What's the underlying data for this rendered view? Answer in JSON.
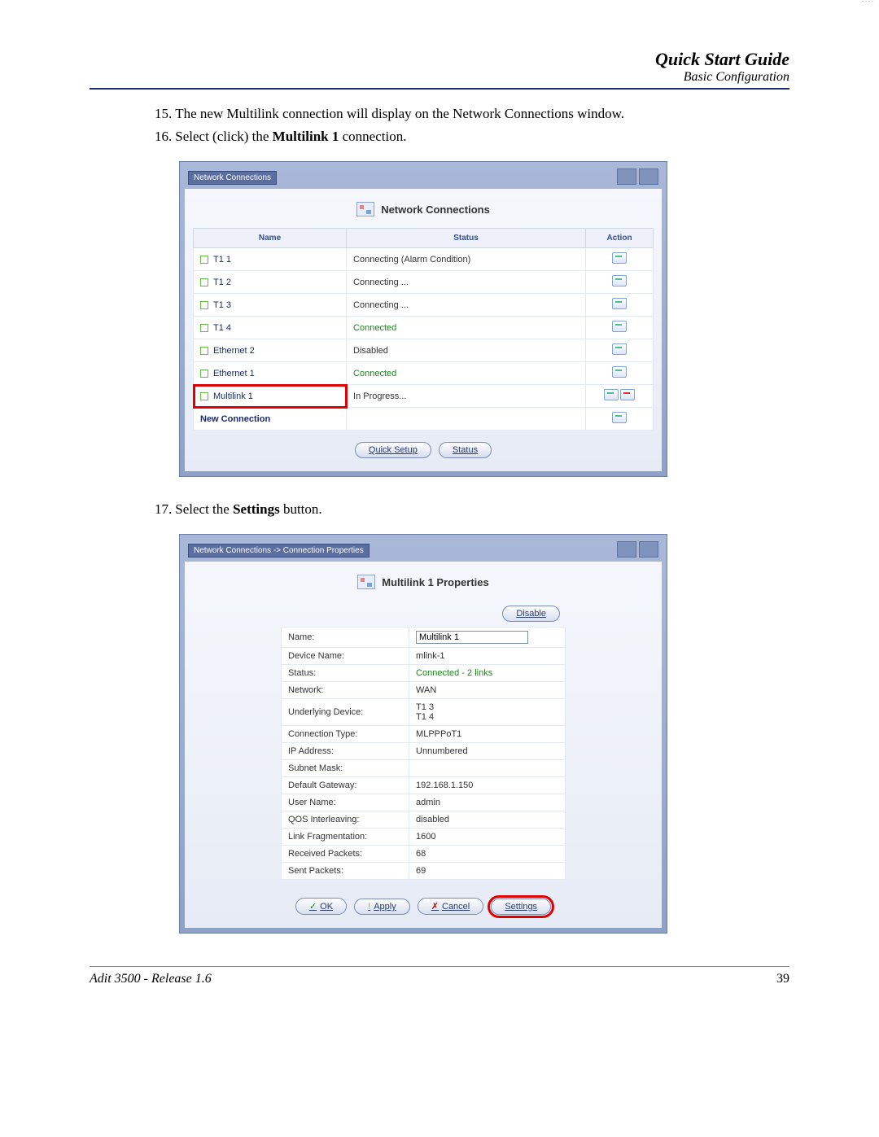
{
  "header": {
    "title": "Quick Start Guide",
    "subtitle": "Basic Configuration"
  },
  "steps": {
    "s15": {
      "num": "15.",
      "text": "The new Multilink connection will display on the Network Connections window."
    },
    "s16": {
      "num": "16.",
      "pre": "Select (click) the ",
      "bold": "Multilink 1",
      "post": " connection."
    },
    "s17": {
      "num": "17.",
      "pre": "Select the ",
      "bold": "Settings",
      "post": " button."
    }
  },
  "panel1": {
    "breadcrumb": "Network Connections",
    "heading": "Network Connections",
    "columns": {
      "name": "Name",
      "status": "Status",
      "action": "Action"
    },
    "rows": [
      {
        "name": "T1 1",
        "status": "Connecting (Alarm Condition)",
        "green": false
      },
      {
        "name": "T1 2",
        "status": "Connecting ...",
        "green": false
      },
      {
        "name": "T1 3",
        "status": "Connecting ...",
        "green": false
      },
      {
        "name": "T1 4",
        "status": "Connected",
        "green": true
      },
      {
        "name": "Ethernet 2",
        "status": "Disabled",
        "green": false
      },
      {
        "name": "Ethernet 1",
        "status": "Connected",
        "green": true
      },
      {
        "name": "Multilink 1",
        "status": "In Progress...",
        "green": false,
        "highlight": true,
        "deletable": true
      }
    ],
    "newConnection": "New Connection",
    "buttons": {
      "quickSetup": "Quick Setup",
      "status": "Status"
    }
  },
  "panel2": {
    "breadcrumb": "Network Connections -> Connection Properties",
    "heading": "Multilink 1 Properties",
    "disable": "Disable",
    "nameInput": "Multilink 1",
    "props": [
      {
        "k": "Name:",
        "v": "__input__"
      },
      {
        "k": "Device Name:",
        "v": "mlink-1"
      },
      {
        "k": "Status:",
        "v": "Connected - 2 links",
        "green": true
      },
      {
        "k": "Network:",
        "v": "WAN"
      },
      {
        "k": "Underlying Device:",
        "v": "T1 3\nT1 4"
      },
      {
        "k": "Connection Type:",
        "v": "MLPPPoT1"
      },
      {
        "k": "IP Address:",
        "v": "Unnumbered"
      },
      {
        "k": "Subnet Mask:",
        "v": ""
      },
      {
        "k": "Default Gateway:",
        "v": "192.168.1.150"
      },
      {
        "k": "User Name:",
        "v": "admin"
      },
      {
        "k": "QOS Interleaving:",
        "v": "disabled"
      },
      {
        "k": "Link Fragmentation:",
        "v": "1600"
      },
      {
        "k": "Received Packets:",
        "v": "68"
      },
      {
        "k": "Sent Packets:",
        "v": "69"
      }
    ],
    "buttons": {
      "ok": "OK",
      "apply": "Apply",
      "cancel": "Cancel",
      "settings": "Settings"
    }
  },
  "footer": {
    "left": "Adit 3500  - Release 1.6",
    "right": "39"
  }
}
